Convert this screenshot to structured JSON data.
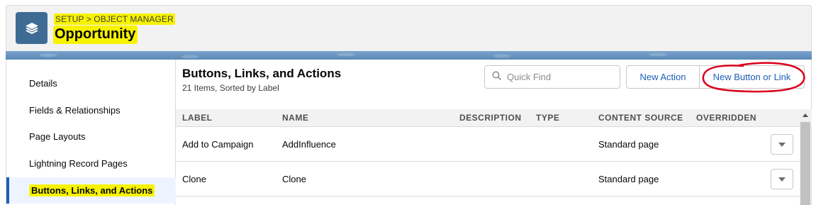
{
  "header": {
    "breadcrumb": "SETUP > OBJECT MANAGER",
    "title": "Opportunity",
    "icon": "layers-icon",
    "highlight_color": "#f7f300",
    "band_color": "#5f8fbf"
  },
  "sidebar": {
    "items": [
      {
        "label": "Details",
        "active": false
      },
      {
        "label": "Fields & Relationships",
        "active": false
      },
      {
        "label": "Page Layouts",
        "active": false
      },
      {
        "label": "Lightning Record Pages",
        "active": false
      },
      {
        "label": "Buttons, Links, and Actions",
        "active": true
      }
    ]
  },
  "main": {
    "title": "Buttons, Links, and Actions",
    "subtitle": "21 Items, Sorted by Label",
    "search": {
      "placeholder": "Quick Find",
      "value": ""
    },
    "buttons": {
      "new_action": "New Action",
      "new_button_or_link": "New Button or Link"
    },
    "table": {
      "columns": [
        "LABEL",
        "NAME",
        "DESCRIPTION",
        "TYPE",
        "CONTENT SOURCE",
        "OVERRIDDEN"
      ],
      "rows": [
        {
          "label": "Add to Campaign",
          "name": "AddInfluence",
          "description": "",
          "type": "",
          "content_source": "Standard page",
          "overridden": ""
        },
        {
          "label": "Clone",
          "name": "Clone",
          "description": "",
          "type": "",
          "content_source": "Standard page",
          "overridden": ""
        }
      ]
    }
  },
  "colors": {
    "link_blue": "#1b5fb7",
    "annotation_red": "#d9001b",
    "icon_bg": "#3e6b93"
  }
}
